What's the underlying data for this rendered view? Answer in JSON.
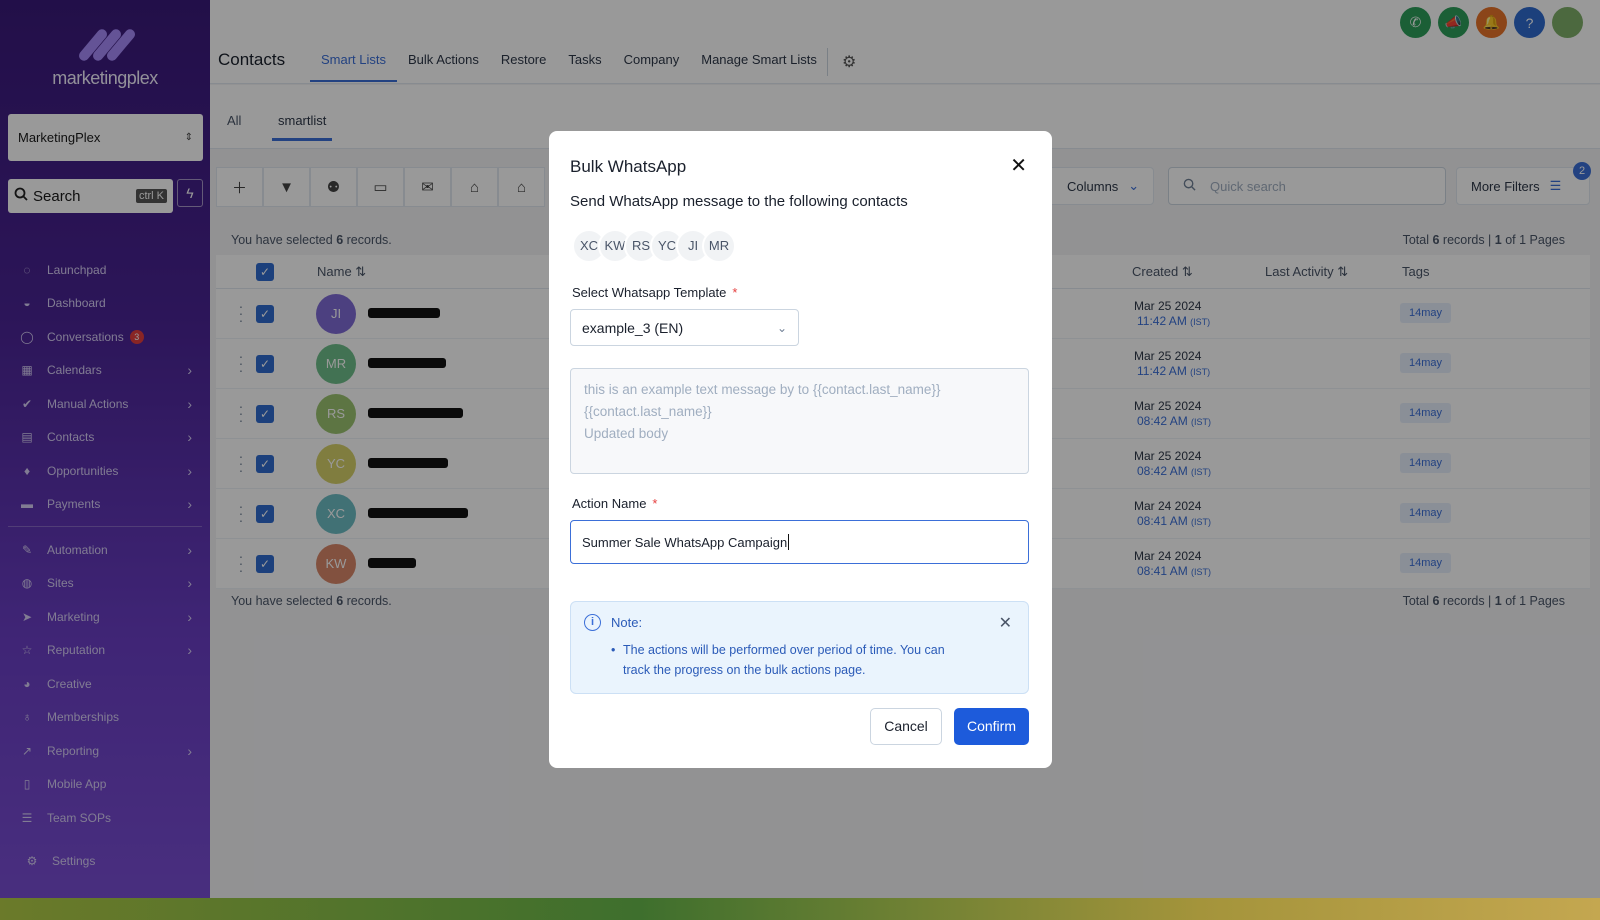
{
  "brand": {
    "name": "marketingplex",
    "accent": "#3b6fd8"
  },
  "sidebar": {
    "account": "MarketingPlex",
    "search_label": "Search",
    "search_shortcut": "ctrl K",
    "items": [
      {
        "label": "Launchpad",
        "icon": "rocket-icon"
      },
      {
        "label": "Dashboard",
        "icon": "gauge-icon"
      },
      {
        "label": "Conversations",
        "icon": "chat-icon",
        "badge": "3"
      },
      {
        "label": "Calendars",
        "icon": "calendar-icon"
      },
      {
        "label": "Manual Actions",
        "icon": "check-circle-icon"
      },
      {
        "label": "Contacts",
        "icon": "contacts-icon"
      },
      {
        "label": "Opportunities",
        "icon": "flame-icon"
      },
      {
        "label": "Payments",
        "icon": "card-icon"
      },
      {
        "label": "Automation",
        "icon": "wand-icon"
      },
      {
        "label": "Sites",
        "icon": "globe-icon"
      },
      {
        "label": "Marketing",
        "icon": "send-icon"
      },
      {
        "label": "Reputation",
        "icon": "star-icon"
      },
      {
        "label": "Creative",
        "icon": "palette-icon"
      },
      {
        "label": "Memberships",
        "icon": "award-icon"
      },
      {
        "label": "Reporting",
        "icon": "chart-icon"
      },
      {
        "label": "Mobile App",
        "icon": "phone-icon"
      },
      {
        "label": "Team SOPs",
        "icon": "list-icon"
      }
    ],
    "settings": "Settings"
  },
  "header": {
    "title": "Contacts",
    "tabs": [
      "Smart Lists",
      "Bulk Actions",
      "Restore",
      "Tasks",
      "Company",
      "Manage Smart Lists"
    ]
  },
  "subtabs": [
    "All",
    "smartlist"
  ],
  "toolbar": {
    "columns": "Columns",
    "quick_search_placeholder": "Quick search",
    "more_filters": "More Filters",
    "filter_count": "2"
  },
  "selection": {
    "prefix": "You have selected",
    "count": "6",
    "suffix": "records."
  },
  "totals": {
    "prefix": "Total",
    "count": "6",
    "mid": "records |",
    "page": "1",
    "of": "of 1 Pages"
  },
  "table": {
    "headers": {
      "name": "Name",
      "created": "Created",
      "last_activity": "Last Activity",
      "tags": "Tags"
    },
    "rows": [
      {
        "initials": "JI",
        "color": "#7f6bd6",
        "date": "Mar 25 2024",
        "time": "11:42 AM",
        "tz": "(IST)",
        "tag": "14may"
      },
      {
        "initials": "MR",
        "color": "#6fbf8a",
        "date": "Mar 25 2024",
        "time": "11:42 AM",
        "tz": "(IST)",
        "tag": "14may"
      },
      {
        "initials": "RS",
        "color": "#9bc470",
        "date": "Mar 25 2024",
        "time": "08:42 AM",
        "tz": "(IST)",
        "tag": "14may"
      },
      {
        "initials": "YC",
        "color": "#d6d06a",
        "date": "Mar 25 2024",
        "time": "08:42 AM",
        "tz": "(IST)",
        "tag": "14may"
      },
      {
        "initials": "XC",
        "color": "#6dbcc4",
        "date": "Mar 24 2024",
        "time": "08:41 AM",
        "tz": "(IST)",
        "tag": "14may"
      },
      {
        "initials": "KW",
        "color": "#d9886a",
        "date": "Mar 24 2024",
        "time": "08:41 AM",
        "tz": "(IST)",
        "tag": "14may"
      }
    ]
  },
  "modal": {
    "title": "Bulk WhatsApp",
    "subtitle": "Send WhatsApp message to the following contacts",
    "contacts": [
      "XC",
      "KW",
      "RS",
      "YC",
      "JI",
      "MR"
    ],
    "template_label": "Select Whatsapp Template",
    "required_mark": "*",
    "template_value": "example_3 (EN)",
    "template_body_line1": "this is an example text message by  to {{contact.last_name}}",
    "template_body_line2": "{{contact.last_name}}",
    "template_body_line3": "Updated body",
    "action_label": "Action Name",
    "action_value": "Summer Sale WhatsApp Campaign",
    "note_title": "Note:",
    "note_text": "The actions will be performed over period of time. You can track the progress on the bulk actions page.",
    "cancel": "Cancel",
    "confirm": "Confirm"
  }
}
